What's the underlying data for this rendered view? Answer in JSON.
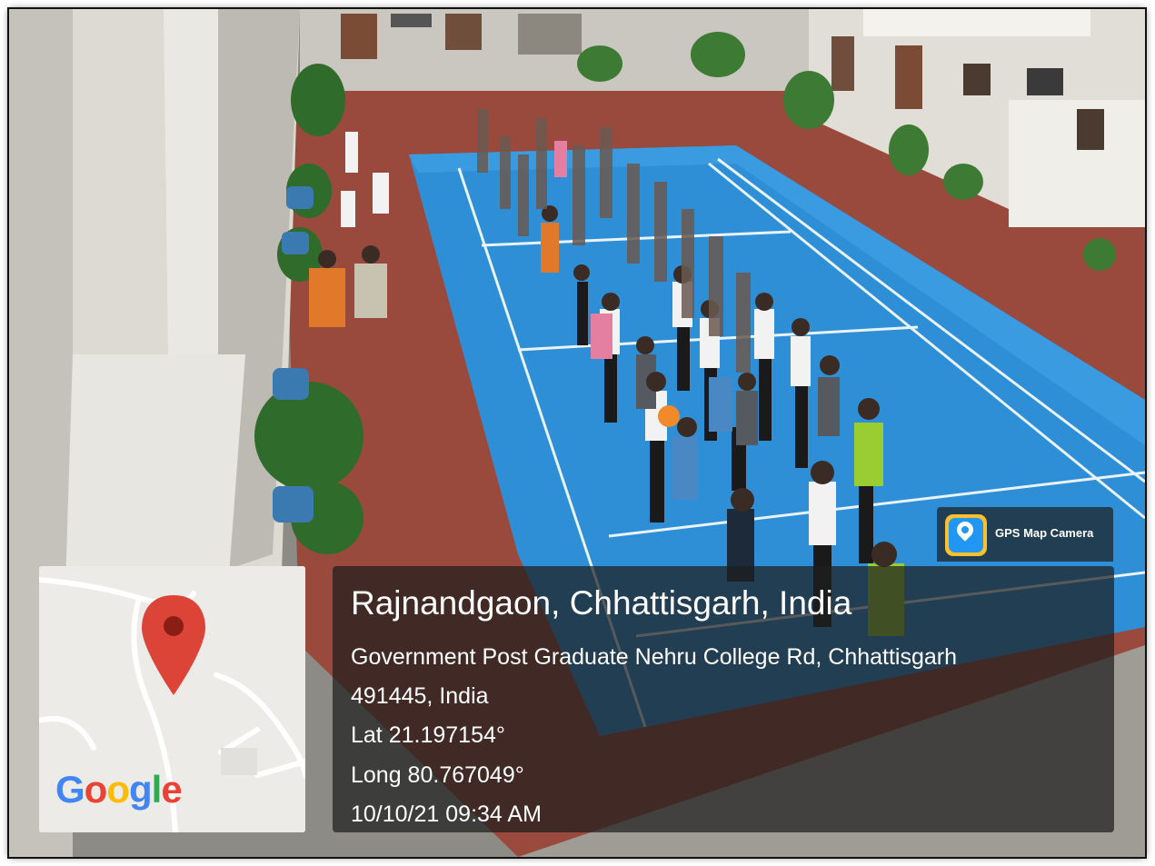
{
  "photo": {
    "description_icon": "photo-scene"
  },
  "map_thumbnail": {
    "icon": "map-pin-icon",
    "pin_color": "#DB4437",
    "logo": {
      "letters": [
        "G",
        "o",
        "o",
        "g",
        "l",
        "e"
      ]
    }
  },
  "badge": {
    "icon": "gps-map-camera-icon",
    "label": "GPS Map Camera"
  },
  "location": {
    "title": "Rajnandgaon, Chhattisgarh, India",
    "address_line1": "Government Post Graduate Nehru College Rd, Chhattisgarh",
    "address_line2": "491445, India",
    "latitude": "Lat 21.197154°",
    "longitude": "Long 80.767049°",
    "timestamp": "10/10/21 09:34 AM"
  }
}
